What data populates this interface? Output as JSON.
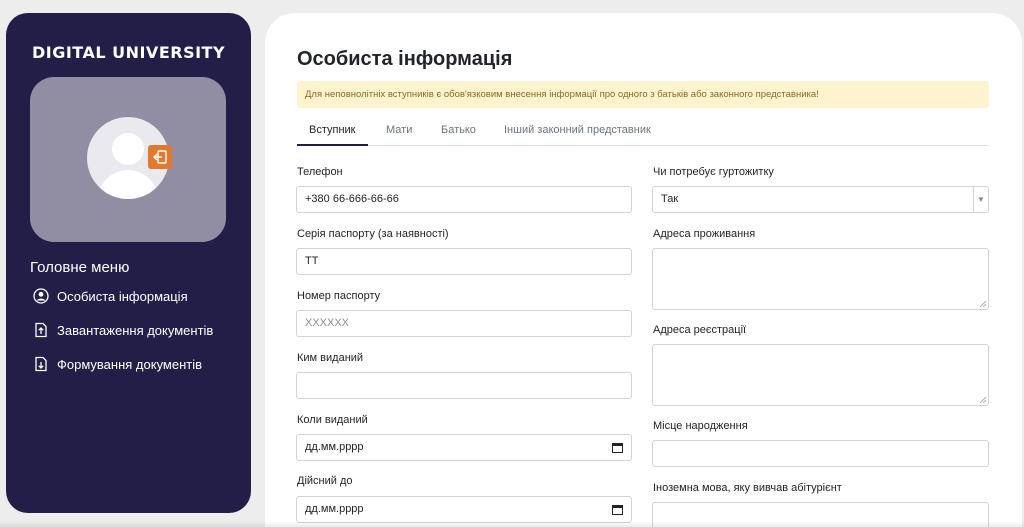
{
  "sidebar": {
    "brand": "DIGITAL UNIVERSITY",
    "menu_title": "Головне меню",
    "items": [
      {
        "label": "Особиста інформація",
        "icon": "user-circle-icon"
      },
      {
        "label": "Завантаження документів",
        "icon": "file-upload-icon"
      },
      {
        "label": "Формування документів",
        "icon": "file-download-icon"
      }
    ]
  },
  "main": {
    "title": "Особиста інформація",
    "alert": "Для неповнолітніх вступників є обов'язковим внесення інформації про одного з батьків або законного представника!",
    "tabs": [
      {
        "label": "Вступник",
        "active": true
      },
      {
        "label": "Мати",
        "active": false
      },
      {
        "label": "Батько",
        "active": false
      },
      {
        "label": "Інший законний представник",
        "active": false
      }
    ],
    "left_fields": {
      "phone": {
        "label": "Телефон",
        "value": "+380 66-666-66-66"
      },
      "passport_series": {
        "label": "Серія паспорту (за наявності)",
        "value": "ТТ"
      },
      "passport_number": {
        "label": "Номер паспорту",
        "placeholder": "XXXXXX"
      },
      "issued_by": {
        "label": "Ким виданий",
        "value": ""
      },
      "issued_date": {
        "label": "Коли виданий",
        "placeholder": "дд.мм.рррр"
      },
      "valid_until": {
        "label": "Дійсний до",
        "placeholder": "дд.мм.рррр"
      }
    },
    "right_fields": {
      "dormitory": {
        "label": "Чи потребує гуртожитку",
        "value": "Так"
      },
      "residence_address": {
        "label": "Адреса проживання",
        "value": ""
      },
      "registration_address": {
        "label": "Адреса реєстрації",
        "value": ""
      },
      "birthplace": {
        "label": "Місце народження",
        "value": ""
      },
      "foreign_language": {
        "label": "Іноземна мова, яку вивчав абітурієнт",
        "value": ""
      }
    }
  },
  "colors": {
    "sidebar_bg": "#221e48",
    "avatar_bg": "#918ea3",
    "logout_accent": "#e07a2f",
    "alert_bg": "#fdf3cf",
    "alert_text": "#8a6d1a"
  }
}
